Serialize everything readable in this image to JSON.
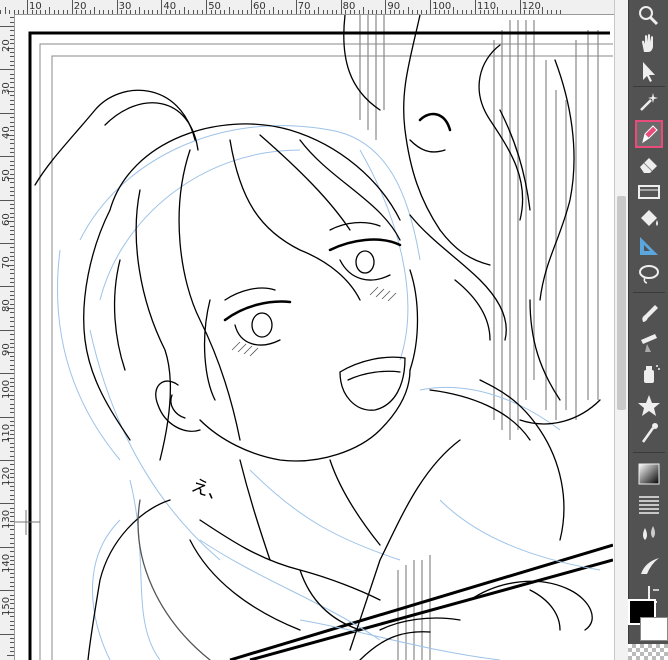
{
  "ruler": {
    "top_labels": [
      "10",
      "20",
      "30",
      "40",
      "50",
      "60",
      "70",
      "80",
      "90",
      "100",
      "110",
      "120"
    ],
    "left_labels": [
      "20",
      "30",
      "40",
      "50",
      "60",
      "70",
      "80",
      "90",
      "100",
      "110",
      "120",
      "130",
      "140",
      "150"
    ]
  },
  "canvas": {
    "speech_text": "え、"
  },
  "toolbar": {
    "tools": [
      {
        "name": "zoom",
        "icon": "magnifier-icon"
      },
      {
        "name": "move",
        "icon": "hand-icon"
      },
      {
        "name": "operation",
        "icon": "cursor-icon"
      },
      {
        "name": "auto-select",
        "icon": "magic-wand-icon"
      },
      {
        "name": "pen",
        "icon": "pen-icon",
        "active": true
      },
      {
        "name": "eraser",
        "icon": "eraser-icon"
      },
      {
        "name": "frame-border",
        "icon": "frame-border-icon"
      },
      {
        "name": "fill",
        "icon": "fill-bucket-icon"
      },
      {
        "name": "ruler",
        "icon": "ruler-triangle-icon"
      },
      {
        "name": "selection",
        "icon": "lasso-icon"
      },
      {
        "name": "brush",
        "icon": "brush-icon"
      },
      {
        "name": "blend",
        "icon": "blend-icon"
      },
      {
        "name": "spray",
        "icon": "spray-icon"
      },
      {
        "name": "star-brush",
        "icon": "star-icon"
      },
      {
        "name": "dropper",
        "icon": "eyedropper-icon"
      },
      {
        "name": "gradient",
        "icon": "gradient-icon"
      },
      {
        "name": "tone",
        "icon": "halftone-icon"
      },
      {
        "name": "liquify",
        "icon": "liquid-drops-icon"
      },
      {
        "name": "text-balloon",
        "icon": "balloon-tail-icon"
      },
      {
        "name": "figure",
        "icon": "figure-icon"
      }
    ],
    "colors": {
      "foreground": "#000000",
      "background": "#ffffff",
      "accent": "#e94b7a"
    }
  }
}
